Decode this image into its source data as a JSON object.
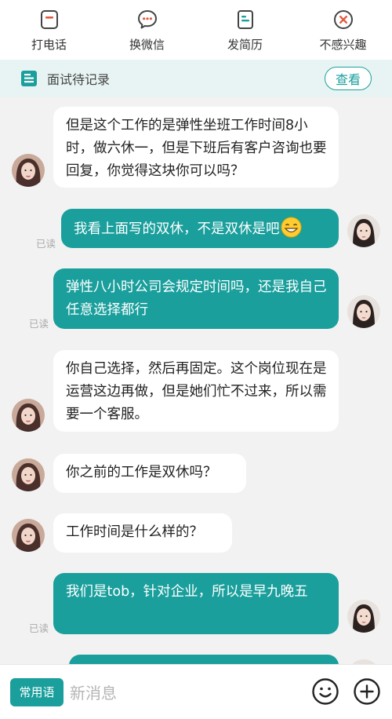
{
  "actions": [
    {
      "label": "打电话",
      "icon": "phone-icon"
    },
    {
      "label": "换微信",
      "icon": "wechat-icon"
    },
    {
      "label": "发简历",
      "icon": "resume-icon"
    },
    {
      "label": "不感兴趣",
      "icon": "not-interested-icon"
    }
  ],
  "record": {
    "label": "面试待记录",
    "button": "查看",
    "icon": "document-icon"
  },
  "messages": [
    {
      "side": "in",
      "text": "但是这个工作的是弹性坐班工作时间8小时，做六休一，但是下班后有客户咨询也要回复，你觉得这块你可以吗？"
    },
    {
      "side": "out",
      "text": "我看上面写的双休，不是双休是吧",
      "emoji": "grinning-emoji",
      "status": "已读"
    },
    {
      "side": "out",
      "text": "弹性八小时公司会规定时间吗，还是我自己任意选择都行",
      "status": "已读"
    },
    {
      "side": "in",
      "text": "你自己选择，然后再固定。这个岗位现在是运营这边再做，但是她们忙不过来，所以需要一个客服。"
    },
    {
      "side": "in",
      "text": "你之前的工作是双休吗？"
    },
    {
      "side": "in",
      "text": "工作时间是什么样的？"
    },
    {
      "side": "out",
      "text": "我们是tob，针对企业，所以是早九晚五",
      "status": "已读"
    }
  ],
  "bottom": {
    "phrases": "常用语",
    "placeholder": "新消息",
    "emoji_icon": "emoji-icon",
    "plus_icon": "plus-icon"
  },
  "colors": {
    "accent": "#1a9f9c",
    "icon_accent": "#e4573d",
    "background": "#f2f2f2"
  }
}
